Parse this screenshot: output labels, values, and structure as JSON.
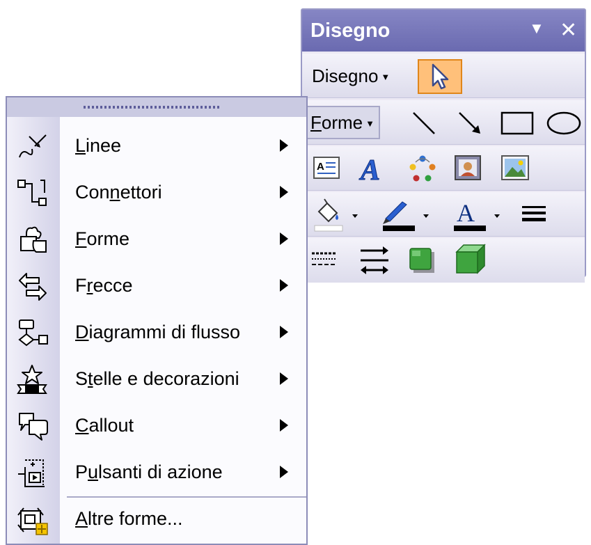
{
  "toolbar": {
    "title": "Disegno",
    "title_dropdown_icon": "triangle-down-icon",
    "close_icon": "close-icon",
    "disegno_menu": {
      "label_pre": "Dise",
      "label_mnemonic": "g",
      "label_post": "no",
      "arrow": "▼"
    },
    "select_tool_icon": "select-pointer-icon",
    "forme_menu": {
      "label_mnemonic": "F",
      "label_post": "orme",
      "arrow": "▼"
    },
    "row2_tools": [
      "line-icon",
      "arrow-icon",
      "rectangle-icon",
      "oval-icon"
    ],
    "row3_tools": [
      "text-box-icon",
      "wordart-icon",
      "diagram-icon",
      "clip-art-icon",
      "picture-icon"
    ],
    "row4_tools": [
      "fill-color-icon",
      "line-color-icon",
      "font-color-icon",
      "line-style-icon"
    ],
    "row5_tools": [
      "dash-style-icon",
      "arrow-style-icon",
      "shadow-style-icon",
      "3d-style-icon"
    ],
    "colors": {
      "fill": "#FFFFFF",
      "line": "#000000",
      "font": "#000000",
      "select_highlight": "#FFC07A"
    }
  },
  "menu": {
    "items": [
      {
        "mnemonic": "L",
        "label_before": "",
        "label_after": "inee",
        "icon": "lines-icon",
        "has_submenu": true
      },
      {
        "mnemonic": "n",
        "label_before": "Con",
        "label_after": "ettori",
        "icon": "connectors-icon",
        "has_submenu": true
      },
      {
        "mnemonic": "F",
        "label_before": "",
        "label_after": "orme",
        "icon": "basic-shapes-icon",
        "has_submenu": true
      },
      {
        "mnemonic": "r",
        "label_before": "F",
        "label_after": "ecce",
        "icon": "block-arrows-icon",
        "has_submenu": true
      },
      {
        "mnemonic": "D",
        "label_before": "",
        "label_after": "iagrammi di flusso",
        "icon": "flowchart-icon",
        "has_submenu": true
      },
      {
        "mnemonic": "t",
        "label_before": "S",
        "label_after": "elle e decorazioni",
        "icon": "stars-banners-icon",
        "has_submenu": true
      },
      {
        "mnemonic": "C",
        "label_before": "",
        "label_after": "allout",
        "icon": "callouts-icon",
        "has_submenu": true
      },
      {
        "mnemonic": "u",
        "label_before": "P",
        "label_after": "lsanti di azione",
        "icon": "action-buttons-icon",
        "has_submenu": true
      },
      {
        "mnemonic": "A",
        "label_before": "",
        "label_after": "ltre forme...",
        "icon": "more-autoshapes-icon",
        "has_submenu": false
      }
    ]
  }
}
